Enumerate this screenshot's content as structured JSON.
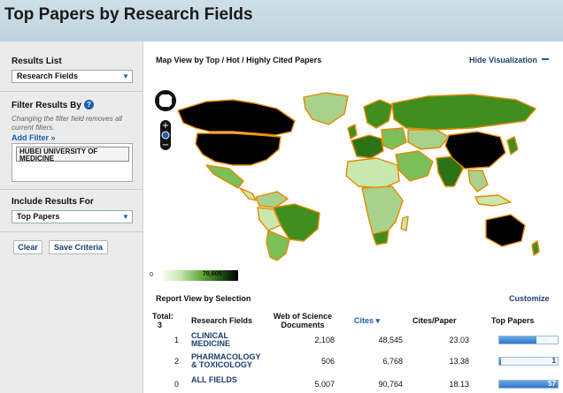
{
  "header": {
    "title": "Top Papers by Research Fields"
  },
  "sidebar": {
    "results_list_label": "Results List",
    "results_list_value": "Research Fields",
    "filter_label": "Filter Results By",
    "help_icon": "?",
    "filter_note": "Changing the filter field removes all current filters.",
    "add_filter": "Add Filter »",
    "filter_value": "HUBEI UNIVERSITY OF MEDICINE",
    "include_label": "Include Results For",
    "include_value": "Top Papers",
    "clear_button": "Clear",
    "save_button": "Save Criteria"
  },
  "visualization": {
    "title": "Map View by Top / Hot / Highly Cited Papers",
    "hide_label": "Hide Visualization",
    "legend_min": "0",
    "legend_max": "70,605"
  },
  "report": {
    "title": "Report View by Selection",
    "customize_label": "Customize",
    "total_label": "Total:",
    "total_value": "3",
    "columns": {
      "field": "Research Fields",
      "wos": "Web of Science Documents",
      "cites": "Cites ▾",
      "cites_paper": "Cites/Paper",
      "top_papers": "Top Papers"
    },
    "rows": [
      {
        "rank": "1",
        "field": "CLINICAL MEDICINE",
        "wos": "2,108",
        "cites": "48,545",
        "cites_paper": "23.03",
        "top_papers": "36",
        "top_fraction": 0.63
      },
      {
        "rank": "2",
        "field": "PHARMACOLOGY & TOXICOLOGY",
        "wos": "506",
        "cites": "6,768",
        "cites_paper": "13.38",
        "top_papers": "1",
        "top_fraction": 0.02
      },
      {
        "rank": "0",
        "field": "ALL FIELDS",
        "wos": "5,007",
        "cites": "90,764",
        "cites_paper": "18.13",
        "top_papers": "57",
        "top_fraction": 1.0
      }
    ]
  },
  "colors": {
    "accent": "#1a5fb0",
    "map_dark": "#000000",
    "map_mid": "#3f8e1f",
    "map_light": "#c9e8b0",
    "map_border": "#e58a00"
  }
}
